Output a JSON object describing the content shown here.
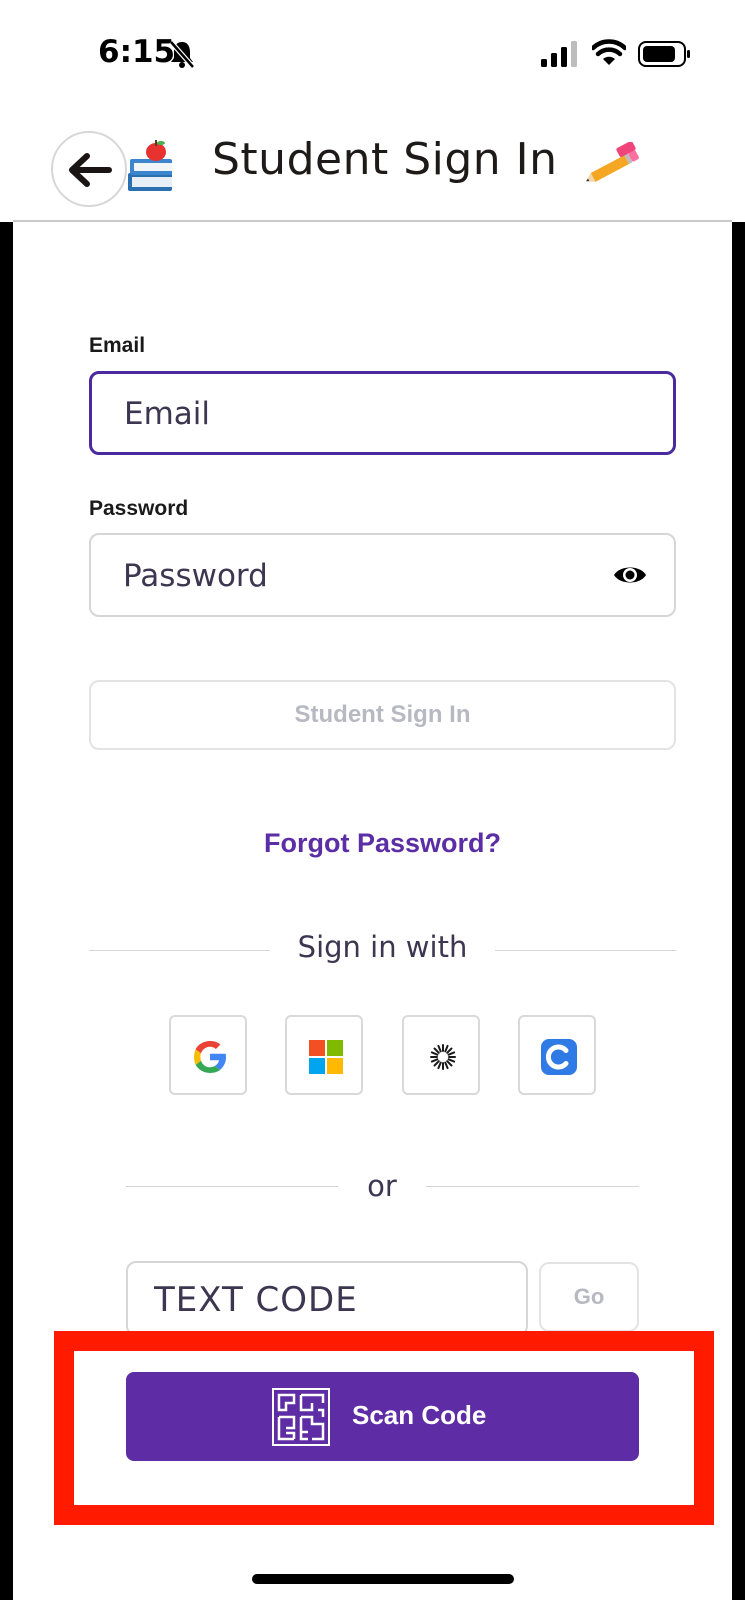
{
  "status_bar": {
    "time": "6:15"
  },
  "header": {
    "title": "Student Sign In",
    "back_icon": "arrow-left-icon",
    "books_icon": "books-apple-icon",
    "pencil_icon": "pencil-eraser-icon"
  },
  "form": {
    "email_label": "Email",
    "email_placeholder": "Email",
    "password_label": "Password",
    "password_placeholder": "Password",
    "signin_button": "Student Sign In",
    "forgot_link": "Forgot Password?"
  },
  "sso": {
    "divider_text": "Sign in with",
    "providers": [
      "google",
      "microsoft",
      "clever-sunburst",
      "classlink"
    ]
  },
  "code": {
    "divider_text": "or",
    "placeholder": "TEXT CODE",
    "go_button": "Go",
    "scan_button": "Scan Code"
  },
  "colors": {
    "accent": "#5e2ca5",
    "link": "#5b2ea6",
    "highlight": "#ff1a00"
  }
}
